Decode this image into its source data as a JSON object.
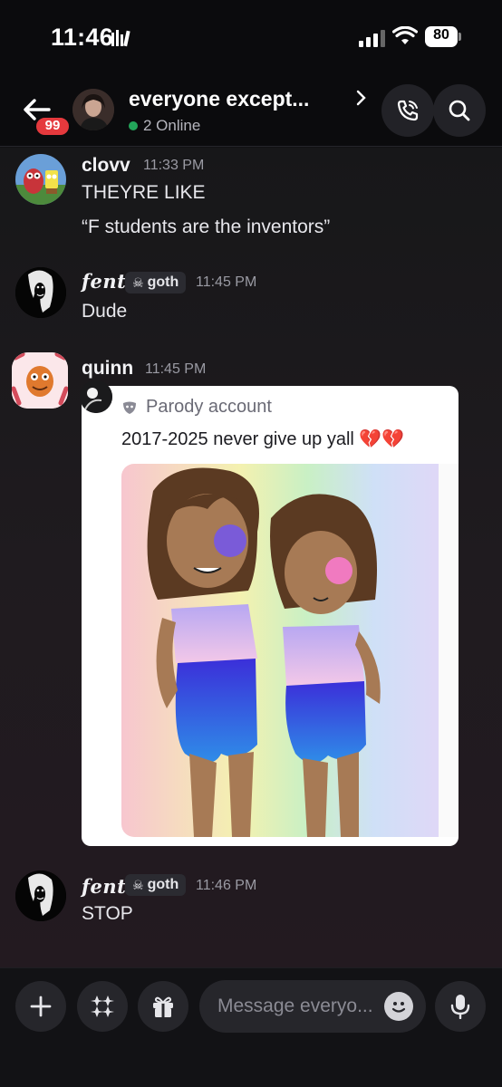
{
  "status_bar": {
    "time": "11:46",
    "battery": "80"
  },
  "header": {
    "unread_badge": "99",
    "title": "everyone except...",
    "online": "2 Online"
  },
  "messages": [
    {
      "user": "clovv",
      "time": "11:33 PM",
      "lines": [
        "THEYRE LIKE",
        "“F students are the inventors”"
      ]
    },
    {
      "user": "fent",
      "tag": "goth",
      "time": "11:45 PM",
      "lines": [
        "Dude"
      ]
    },
    {
      "user": "quinn",
      "time": "11:45 PM",
      "embed": {
        "source": "Parody account",
        "text": "2017-2025 never give up yall 💔💔"
      }
    },
    {
      "user": "fent",
      "tag": "goth",
      "time": "11:46 PM",
      "lines": [
        "STOP"
      ]
    }
  ],
  "composer": {
    "placeholder": "Message everyo..."
  },
  "icons": [
    "back-arrow-icon",
    "call-icon",
    "search-icon",
    "plus-icon",
    "apps-icon",
    "gift-icon",
    "emoji-icon",
    "microphone-icon",
    "skull-icon",
    "mask-icon"
  ],
  "colors": {
    "background": "#111114",
    "online": "#23a55a",
    "badge": "#e5393d"
  }
}
